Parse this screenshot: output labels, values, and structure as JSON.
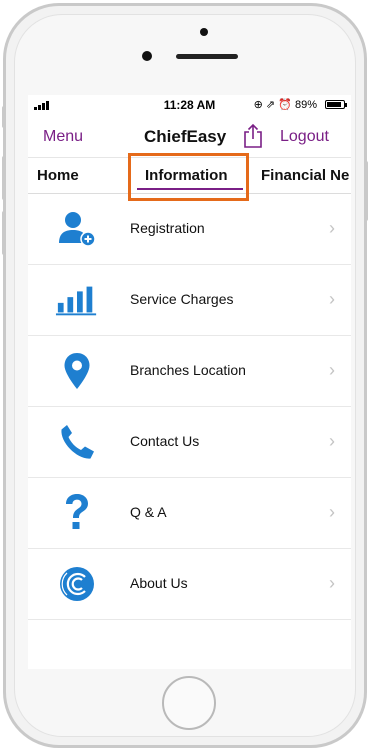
{
  "status_bar": {
    "time": "11:28 AM",
    "icons": "⊕ ⇗ ⏰",
    "battery_text": "89%",
    "battery_level": 0.89
  },
  "navbar": {
    "menu_label": "Menu",
    "title": "ChiefEasy",
    "logout_label": "Logout"
  },
  "tabs": [
    {
      "label": "Home"
    },
    {
      "label": "Information"
    },
    {
      "label": "Financial Ne"
    }
  ],
  "list": [
    {
      "label": "Registration",
      "icon": "add-user-icon"
    },
    {
      "label": "Service Charges",
      "icon": "bar-chart-icon"
    },
    {
      "label": "Branches Location",
      "icon": "location-pin-icon"
    },
    {
      "label": "Contact Us",
      "icon": "phone-icon"
    },
    {
      "label": "Q & A",
      "icon": "question-icon"
    },
    {
      "label": "About Us",
      "icon": "company-logo-icon"
    }
  ],
  "colors": {
    "accent": "#7a1f86",
    "icon_blue": "#1e7fd0",
    "highlight": "#e56a1a"
  }
}
